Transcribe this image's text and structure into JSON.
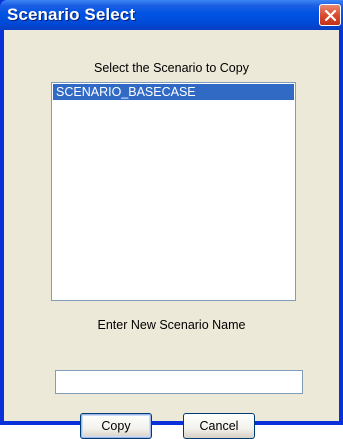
{
  "window": {
    "title": "Scenario Select"
  },
  "dialog": {
    "list_label": "Select the Scenario to Copy",
    "scenarios": [
      "SCENARIO_BASECASE"
    ],
    "name_label": "Enter New Scenario Name",
    "name_value": "",
    "copy_label": "Copy",
    "cancel_label": "Cancel"
  },
  "colors": {
    "titlebar": "#0054e3",
    "selection": "#316ac5",
    "dialog_bg": "#ece9d8",
    "close_button": "#d9472c"
  },
  "icons": {
    "close": "close-icon"
  }
}
